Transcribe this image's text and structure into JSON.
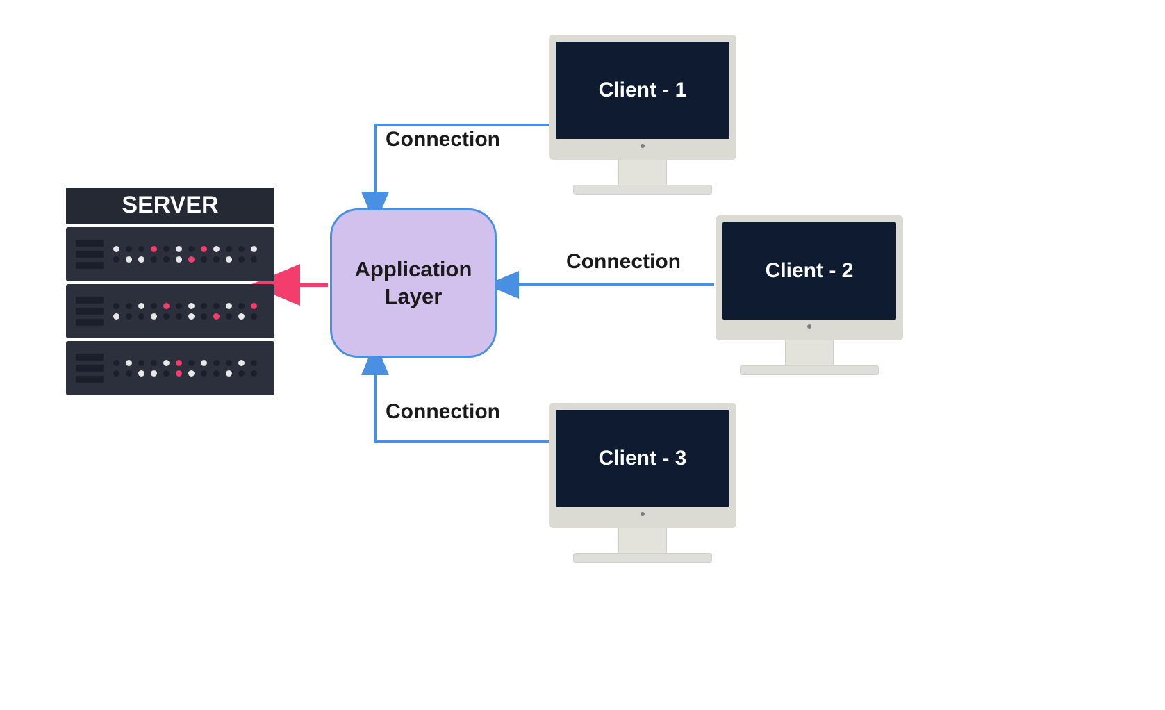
{
  "diagram": {
    "server_label": "SERVER",
    "app_layer_label": "Application Layer",
    "clients": [
      {
        "label": "Client - 1",
        "connection_label": "Connection"
      },
      {
        "label": "Client - 2",
        "connection_label": "Connection"
      },
      {
        "label": "Client - 3",
        "connection_label": "Connection"
      }
    ],
    "colors": {
      "arrow_blue": "#4a90e2",
      "arrow_pink": "#f23d6d",
      "app_box_bg": "#d2c1ec",
      "screen_bg": "#0e1b30",
      "rack_bg": "#2b303c"
    }
  }
}
